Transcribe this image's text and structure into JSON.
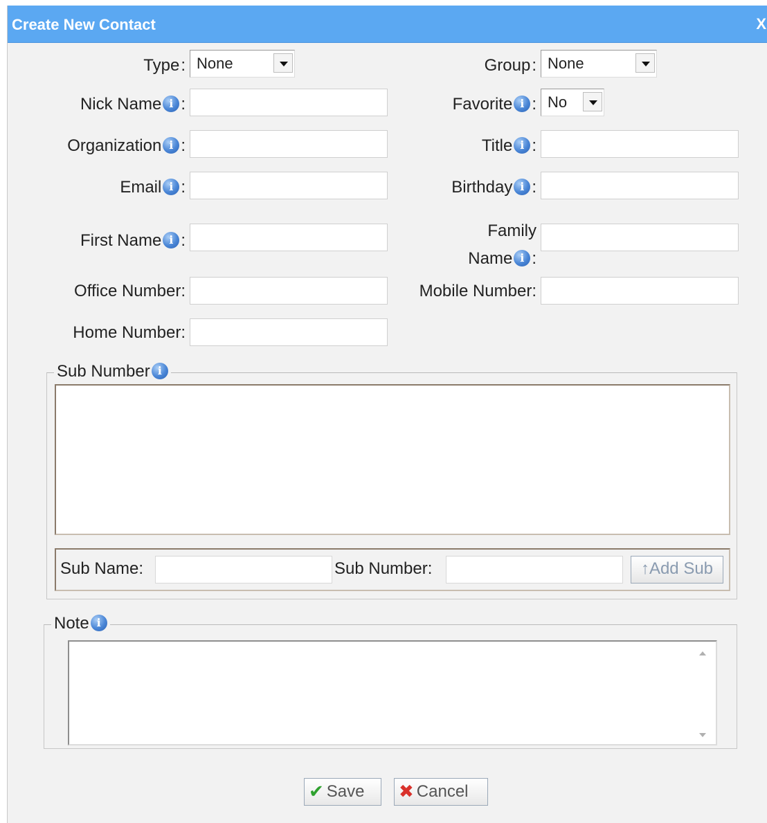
{
  "window": {
    "title": "Create New Contact",
    "close_label": "X"
  },
  "fields": {
    "type": {
      "label": "Type",
      "value": "None"
    },
    "group": {
      "label": "Group",
      "value": "None"
    },
    "nick_name": {
      "label": "Nick Name",
      "value": ""
    },
    "favorite": {
      "label": "Favorite",
      "value": "No"
    },
    "organization": {
      "label": "Organization",
      "value": ""
    },
    "title": {
      "label": "Title",
      "value": ""
    },
    "email": {
      "label": "Email",
      "value": ""
    },
    "birthday": {
      "label": "Birthday",
      "value": ""
    },
    "first_name": {
      "label": "First Name",
      "value": ""
    },
    "family_name": {
      "label_line1": "Family",
      "label_line2": "Name",
      "value": ""
    },
    "office_number": {
      "label": "Office Number:",
      "value": ""
    },
    "mobile_number": {
      "label": "Mobile Number:",
      "value": ""
    },
    "home_number": {
      "label": "Home Number:",
      "value": ""
    }
  },
  "sub_number_section": {
    "legend": "Sub Number",
    "sub_name_label": "Sub Name:",
    "sub_number_label": "Sub Number:",
    "sub_name_value": "",
    "sub_number_value": "",
    "add_button_label": "↑Add Sub"
  },
  "note_section": {
    "legend": "Note",
    "value": ""
  },
  "actions": {
    "save_label": "Save",
    "cancel_label": "Cancel"
  },
  "colors": {
    "titlebar": "#5ba8f2",
    "dialog_bg": "#f2f2f2",
    "info_icon": "#4a86d6",
    "save_check": "#2fa12f",
    "cancel_x": "#d9312b"
  },
  "icons": {
    "info": "info-circle-icon",
    "save": "check-icon",
    "cancel": "x-icon"
  }
}
